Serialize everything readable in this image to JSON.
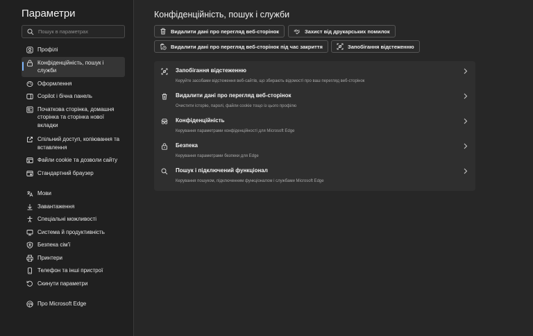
{
  "sidebar": {
    "title": "Параметри",
    "search_placeholder": "Пошук в параметрах",
    "items": [
      {
        "label": "Профілі",
        "icon": "profile-icon"
      },
      {
        "label": "Конфіденційність, пошук і служби",
        "icon": "lock-icon",
        "active": true
      },
      {
        "label": "Оформлення",
        "icon": "appearance-icon"
      },
      {
        "label": "Copilot і бічна панель",
        "icon": "sidebar-icon"
      },
      {
        "label": "Початкова сторінка, домашня сторінка та сторінка нової вкладки",
        "icon": "home-icon"
      },
      {
        "label": "Спільний доступ, копіювання та вставлення",
        "icon": "share-icon"
      },
      {
        "label": "Файли cookie та дозволи сайту",
        "icon": "site-permissions-icon"
      },
      {
        "label": "Стандартний браузер",
        "icon": "browser-icon"
      },
      {
        "label": "Мови",
        "icon": "languages-icon"
      },
      {
        "label": "Завантаження",
        "icon": "download-icon"
      },
      {
        "label": "Спеціальні можливості",
        "icon": "accessibility-icon"
      },
      {
        "label": "Система й продуктивність",
        "icon": "system-icon"
      },
      {
        "label": "Безпека сім'ї",
        "icon": "family-icon"
      },
      {
        "label": "Принтери",
        "icon": "printer-icon"
      },
      {
        "label": "Телефон та інші пристрої",
        "icon": "phone-icon"
      },
      {
        "label": "Скинути параметри",
        "icon": "reset-icon"
      },
      {
        "label": "Про Microsoft Edge",
        "icon": "edge-icon"
      }
    ]
  },
  "main": {
    "title": "Конфіденційність, пошук і служби",
    "quick_actions": [
      {
        "label": "Видалити дані про перегляд веб-сторінок",
        "icon": "trash-icon"
      },
      {
        "label": "Захист від друкарських помилок",
        "icon": "typo-protection-icon"
      },
      {
        "label": "Видалити дані про перегляд веб-сторінок під час закриття",
        "icon": "trash-clock-icon"
      },
      {
        "label": "Запобігання відстеженню",
        "icon": "tracking-prevention-icon"
      }
    ],
    "rows": [
      {
        "title": "Запобігання відстеженню",
        "subtitle": "Керуйте засобами відстеження веб-сайтів, що збирають відомості про ваш перегляд веб-сторінок",
        "icon": "tracking-prevention-icon"
      },
      {
        "title": "Видалити дані про перегляд веб-сторінок",
        "subtitle": "Очистити історію, паролі, файли cookie тощо із цього профілю",
        "icon": "trash-icon"
      },
      {
        "title": "Конфіденційність",
        "subtitle": "Керування параметрами конфіденційності для Microsoft Edge",
        "icon": "privacy-icon"
      },
      {
        "title": "Безпека",
        "subtitle": "Керування параметрами безпеки для Edge",
        "icon": "security-icon"
      },
      {
        "title": "Пошук і підключений функціонал",
        "subtitle": "Керування пошуком, підключенним функціоналом і службами Microsoft Edge",
        "icon": "search-icon"
      }
    ]
  },
  "colors": {
    "background": "#272727",
    "sidebar": "#202020",
    "card": "#2f2f2f",
    "accent": "#7fb7ff"
  }
}
